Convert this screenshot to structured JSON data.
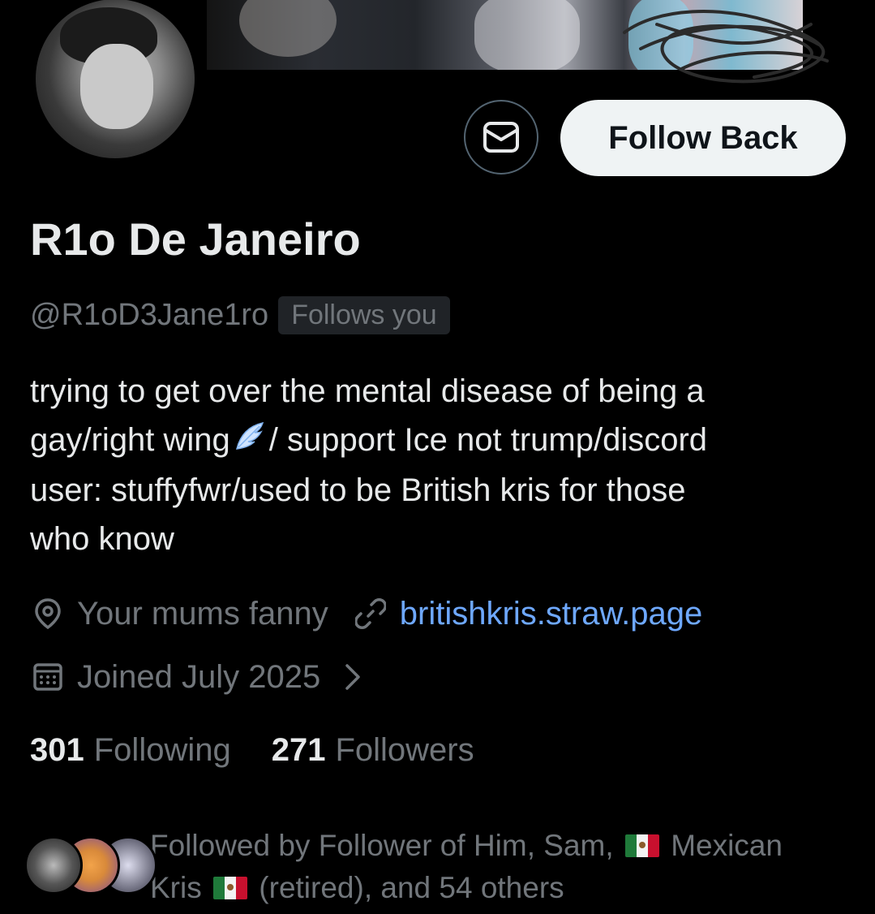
{
  "profile": {
    "display_name": "R1o De Janeiro",
    "handle": "@R1oD3Jane1ro",
    "follows_you_badge": "Follows you",
    "bio": {
      "line1": "trying to get over the mental disease of being a",
      "line2_pre": "gay/right wing",
      "line2_post": "/ support Ice not trump/discord",
      "line3": "user: stuffyfwr/used to be British kris for those",
      "line4": "who know"
    },
    "location": "Your mums fanny",
    "website": "britishkris.straw.page",
    "joined": "Joined July 2025"
  },
  "actions": {
    "follow_back_label": "Follow Back",
    "message_icon": "envelope-icon"
  },
  "stats": {
    "following_count": "301",
    "following_label": "Following",
    "followers_count": "271",
    "followers_label": "Followers"
  },
  "followed_by": {
    "part1": "Followed by Follower of Him, Sam,",
    "part2": "Mexican",
    "part3": "Kris",
    "part4": "(retired), and 54 others"
  },
  "colors": {
    "background": "#000000",
    "primary_text": "#e7e9ea",
    "secondary_text": "#71767b",
    "link": "#6ea8ff",
    "button_bg": "#eff3f4"
  }
}
